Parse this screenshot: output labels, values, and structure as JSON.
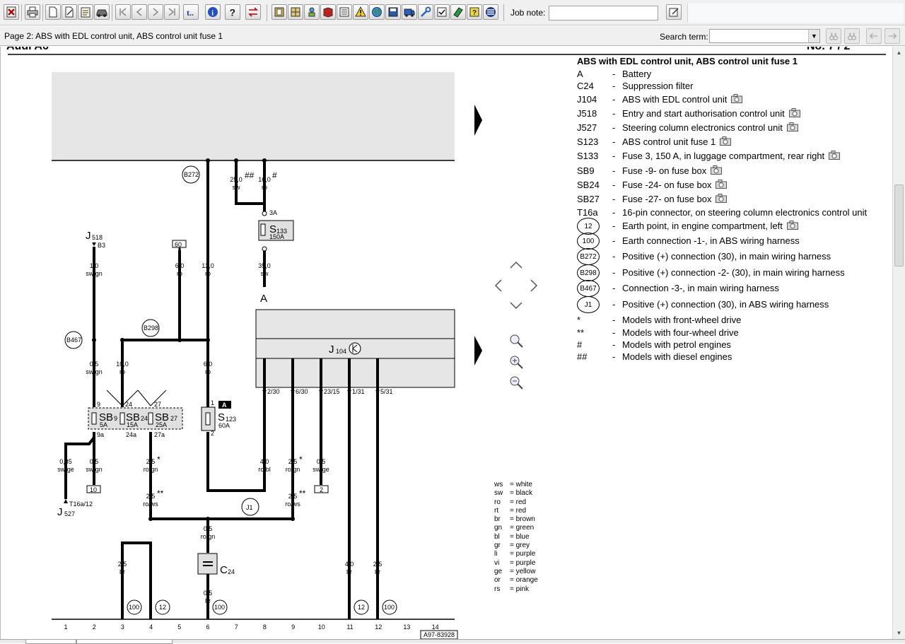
{
  "toolbar": {
    "job_note_label": "Job note:",
    "job_note_value": "",
    "icons": [
      "exit-icon",
      "print-icon",
      "new-document-icon",
      "edit-icon",
      "notes-icon",
      "vehicle-icon",
      "first-page-icon",
      "previous-page-icon",
      "next-page-icon",
      "last-page-icon",
      "text-search-icon",
      "info-icon",
      "help-icon",
      "swap-icon",
      "book-icon",
      "grid-icon",
      "tree-icon",
      "manual-icon",
      "document-icon",
      "warning-icon",
      "globe-icon",
      "save-icon",
      "van-icon",
      "checklist-icon",
      "green-book-icon",
      "question-book-icon",
      "menu-lines-icon"
    ]
  },
  "pagebar": {
    "title": "Page 2: ABS with EDL control unit, ABS control unit fuse 1",
    "search_label": "Search term:",
    "search_value": ""
  },
  "legend": {
    "title": "ABS with EDL control unit, ABS control unit fuse 1",
    "items": [
      {
        "code": "A",
        "desc": "Battery",
        "photo": false,
        "circled": false
      },
      {
        "code": "C24",
        "desc": "Suppression filter",
        "photo": false,
        "circled": false
      },
      {
        "code": "J104",
        "desc": "ABS with EDL control unit",
        "photo": true,
        "circled": false
      },
      {
        "code": "J518",
        "desc": "Entry and start authorisation control unit",
        "photo": true,
        "circled": false
      },
      {
        "code": "J527",
        "desc": "Steering column electronics control unit",
        "photo": true,
        "circled": false
      },
      {
        "code": "S123",
        "desc": "ABS control unit fuse 1",
        "photo": true,
        "circled": false
      },
      {
        "code": "S133",
        "desc": "Fuse 3, 150 A, in luggage compartment, rear right",
        "photo": true,
        "circled": false
      },
      {
        "code": "SB9",
        "desc": "Fuse -9- on fuse box",
        "photo": true,
        "circled": false
      },
      {
        "code": "SB24",
        "desc": "Fuse -24- on fuse box",
        "photo": true,
        "circled": false
      },
      {
        "code": "SB27",
        "desc": "Fuse -27- on fuse box",
        "photo": true,
        "circled": false
      },
      {
        "code": "T16a",
        "desc": "16-pin connector, on steering column electronics control unit",
        "photo": false,
        "circled": false
      },
      {
        "code": "12",
        "desc": "Earth point, in engine compartment, left",
        "photo": true,
        "circled": true
      },
      {
        "code": "100",
        "desc": "Earth connection -1-, in ABS wiring harness",
        "photo": false,
        "circled": true
      },
      {
        "code": "B272",
        "desc": "Positive (+) connection (30), in main wiring harness",
        "photo": false,
        "circled": true
      },
      {
        "code": "B298",
        "desc": "Positive (+) connection -2- (30), in main wiring harness",
        "photo": false,
        "circled": true
      },
      {
        "code": "B467",
        "desc": "Connection -3-, in main wiring harness",
        "photo": false,
        "circled": true
      },
      {
        "code": "J1",
        "desc": "Positive (+) connection (30), in ABS wiring harness",
        "photo": false,
        "circled": true
      },
      {
        "code": "*",
        "desc": "Models with front-wheel drive",
        "photo": false,
        "circled": false
      },
      {
        "code": "**",
        "desc": "Models with four-wheel drive",
        "photo": false,
        "circled": false
      },
      {
        "code": "#",
        "desc": "Models with petrol engines",
        "photo": false,
        "circled": false
      },
      {
        "code": "##",
        "desc": "Models with diesel engines",
        "photo": false,
        "circled": false
      }
    ]
  },
  "colour_codes": [
    {
      "code": "ws",
      "name": "white"
    },
    {
      "code": "sw",
      "name": "black"
    },
    {
      "code": "ro",
      "name": "red"
    },
    {
      "code": "rt",
      "name": "red"
    },
    {
      "code": "br",
      "name": "brown"
    },
    {
      "code": "gn",
      "name": "green"
    },
    {
      "code": "bl",
      "name": "blue"
    },
    {
      "code": "gr",
      "name": "grey"
    },
    {
      "code": "li",
      "name": "purple"
    },
    {
      "code": "vi",
      "name": "purple"
    },
    {
      "code": "ge",
      "name": "yellow"
    },
    {
      "code": "or",
      "name": "orange"
    },
    {
      "code": "rs",
      "name": "pink"
    }
  ],
  "diagram": {
    "header_cut_left": "Audi A6",
    "header_cut_right": "No. 7 / 2",
    "battery_label": "A",
    "ref_number": "A97-83928",
    "track_numbers": [
      "1",
      "2",
      "3",
      "4",
      "5",
      "6",
      "7",
      "8",
      "9",
      "10",
      "11",
      "12",
      "13",
      "14"
    ],
    "connectors": {
      "B272": "B272",
      "B298": "B298",
      "B467": "B467",
      "J1": "J1",
      "earth_100": "100",
      "earth_12": "12"
    },
    "components": {
      "J518": "J",
      "J518_sub": "518",
      "J518_pin": "B3",
      "J527": "J",
      "J527_sub": "527",
      "T16a_pin": "T16a/12",
      "S133": "S",
      "S133_sub": "133",
      "S133_rating": "150A",
      "S133_3A": "3A",
      "S123": "S",
      "S123_sub": "123",
      "S123_rating": "60A",
      "S123_tag": "A",
      "SB9": "SB",
      "SB9_sub": "9",
      "SB9_rating": "5A",
      "SB24": "SB",
      "SB24_sub": "24",
      "SB24_rating": "15A",
      "SB27": "SB",
      "SB27_sub": "27",
      "SB27_rating": "25A",
      "J104": "J",
      "J104_sub": "104",
      "C24": "C",
      "C24_sub": "24"
    },
    "wires": {
      "w_25sw": [
        "25,0",
        "sw",
        "##"
      ],
      "w_16ro": [
        "16,0",
        "ro",
        "#"
      ],
      "w_35sw": [
        "35,0",
        "sw"
      ],
      "w_1swgn": [
        "1,0",
        "sw/gn"
      ],
      "w_6ro": [
        "6,0",
        "ro"
      ],
      "w_12ro": [
        "12,0",
        "ro"
      ],
      "w_05swgn": [
        "0,5",
        "sw/gn"
      ],
      "w_10ro": [
        "10,0",
        "ro"
      ],
      "w_6ro_b": [
        "6,0",
        "ro"
      ],
      "w_035swge": [
        "0,35",
        "sw/ge"
      ],
      "w_05swgn_b": [
        "0,5",
        "sw/gn"
      ],
      "w_25rogn": [
        "2,5",
        "ro/gn",
        "*"
      ],
      "w_25rows": [
        "2,5",
        "ro/ws",
        "**"
      ],
      "w_4robl": [
        "4,0",
        "ro/bl"
      ],
      "w_25rogn_b": [
        "2,5",
        "ro/gn",
        "*"
      ],
      "w_25rows_b": [
        "2,5",
        "ro/ws",
        "**"
      ],
      "w_05swge": [
        "0,5",
        "sw/ge"
      ],
      "w_05rogn": [
        "0,5",
        "ro/gn"
      ],
      "w_25br": [
        "2,5",
        "br"
      ],
      "w_05br": [
        "0,5",
        "br"
      ],
      "w_4br": [
        "4,0",
        "br"
      ],
      "w_25br_b": [
        "2,5",
        "br"
      ]
    },
    "pins": {
      "p9": "9",
      "p24": "24",
      "p27": "27",
      "p9a": "9a",
      "p24a": "24a",
      "p27a": "27a",
      "p1": "1",
      "p2": "2",
      "j230": "2/30",
      "j630": "6/30",
      "j2315": "23/15",
      "j131": "1/31",
      "j531": "5/31",
      "box60": "60",
      "box10": "10",
      "box2": "2"
    }
  }
}
